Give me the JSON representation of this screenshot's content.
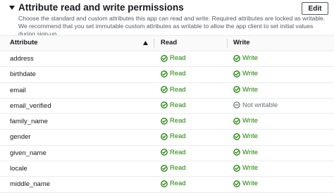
{
  "panel": {
    "title": "Attribute read and write permissions",
    "description": "Choose the standard and custom attributes this app can read and write. Required attributes are locked as writable. We recommend that you set immutable custom attributes as writable to allow the app client to set initial values during sign-up.",
    "edit_label": "Edit"
  },
  "table": {
    "columns": {
      "attribute": "Attribute",
      "read": "Read",
      "write": "Write"
    },
    "rows": [
      {
        "attribute": "address",
        "read": "Read",
        "write": "Write",
        "writable": true
      },
      {
        "attribute": "birthdate",
        "read": "Read",
        "write": "Write",
        "writable": true
      },
      {
        "attribute": "email",
        "read": "Read",
        "write": "Write",
        "writable": true
      },
      {
        "attribute": "email_verified",
        "read": "Read",
        "write": "Not writable",
        "writable": false
      },
      {
        "attribute": "family_name",
        "read": "Read",
        "write": "Write",
        "writable": true
      },
      {
        "attribute": "gender",
        "read": "Read",
        "write": "Write",
        "writable": true
      },
      {
        "attribute": "given_name",
        "read": "Read",
        "write": "Write",
        "writable": true
      },
      {
        "attribute": "locale",
        "read": "Read",
        "write": "Write",
        "writable": true
      },
      {
        "attribute": "middle_name",
        "read": "Read",
        "write": "Write",
        "writable": true
      }
    ]
  },
  "colors": {
    "success": "#1d8102",
    "disabled": "#687078"
  },
  "icons": {
    "expand": "caret-down-icon",
    "sort": "sort-ascending-icon",
    "ok": "check-circle-icon",
    "na": "dash-circle-icon"
  }
}
